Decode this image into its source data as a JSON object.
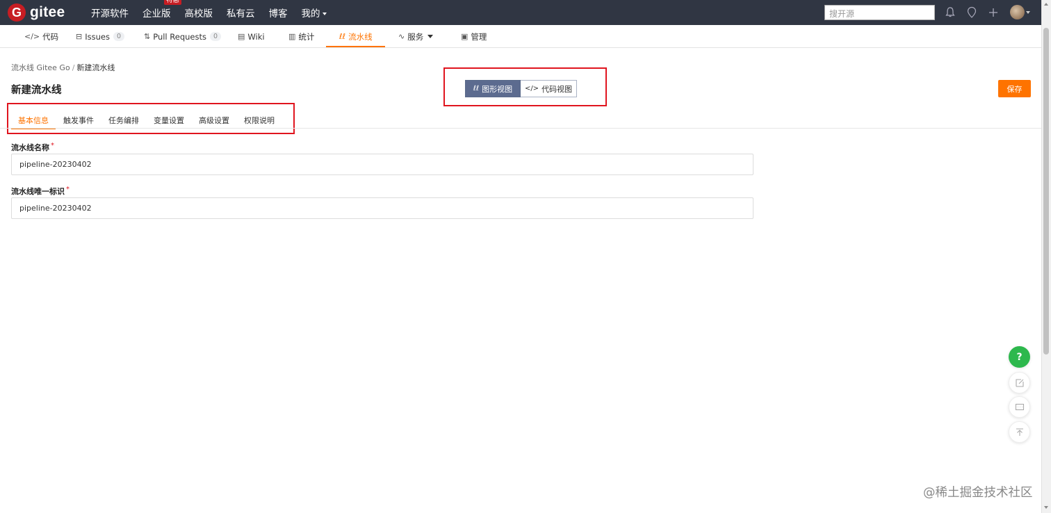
{
  "topbar": {
    "logo_letter": "G",
    "logo_text": "gitee",
    "nav": [
      "开源软件",
      "企业版",
      "高校版",
      "私有云",
      "博客",
      "我的"
    ],
    "hot_badge": "特惠",
    "search_placeholder": "搜开源",
    "bg_color": "#303643"
  },
  "repo_tabs": [
    {
      "icon": "code-icon",
      "glyph": "</>",
      "label": "代码"
    },
    {
      "icon": "issues-icon",
      "glyph": "⊟",
      "label": "Issues",
      "count": "0"
    },
    {
      "icon": "pull-request-icon",
      "glyph": "⇅",
      "label": "Pull Requests",
      "count": "0"
    },
    {
      "icon": "wiki-icon",
      "glyph": "▤",
      "label": "Wiki"
    },
    {
      "icon": "stats-icon",
      "glyph": "▥",
      "label": "统计"
    },
    {
      "icon": "pipeline-icon",
      "glyph": "ℓℓ",
      "label": "流水线",
      "active": true
    },
    {
      "icon": "service-icon",
      "glyph": "∿",
      "label": "服务"
    },
    {
      "icon": "manage-icon",
      "glyph": "▣",
      "label": "管理"
    }
  ],
  "breadcrumb": {
    "parent": "流水线 Gitee Go",
    "sep": "/",
    "current": "新建流水线"
  },
  "page_title": "新建流水线",
  "view_toggle": {
    "graph": "图形视图",
    "code": "代码视图"
  },
  "save_label": "保存",
  "sub_tabs": [
    "基本信息",
    "触发事件",
    "任务编排",
    "变量设置",
    "高级设置",
    "权限说明"
  ],
  "form": {
    "name_label": "流水线名称",
    "name_value": "pipeline-20230402",
    "id_label": "流水线唯一标识",
    "id_value": "pipeline-20230402",
    "required_mark": "*"
  },
  "floating": {
    "help": "?"
  },
  "watermark": "@稀土掘金技术社区",
  "colors": {
    "accent": "#fe7300",
    "annotation_red": "#e0141e",
    "help_green": "#2db84d"
  }
}
